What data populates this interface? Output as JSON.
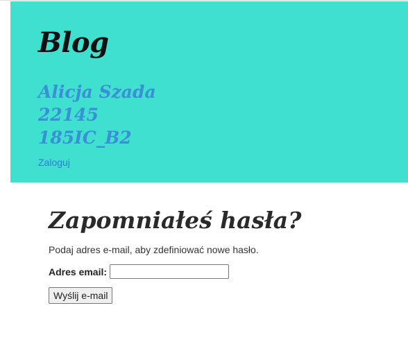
{
  "header": {
    "site_title": "Blog",
    "author_lines": [
      "Alicja Szada",
      "22145",
      "185IC_B2"
    ],
    "login_link": "Zaloguj",
    "background_color": "#40e0d0",
    "author_color": "#3a8fd6"
  },
  "main": {
    "title": "Zapomniałeś hasła?",
    "intro_text": "Podaj adres e-mail, aby zdefiniować nowe hasło.",
    "email_label": "Adres email:",
    "email_value": "",
    "submit_label": "Wyślij e-mail"
  }
}
